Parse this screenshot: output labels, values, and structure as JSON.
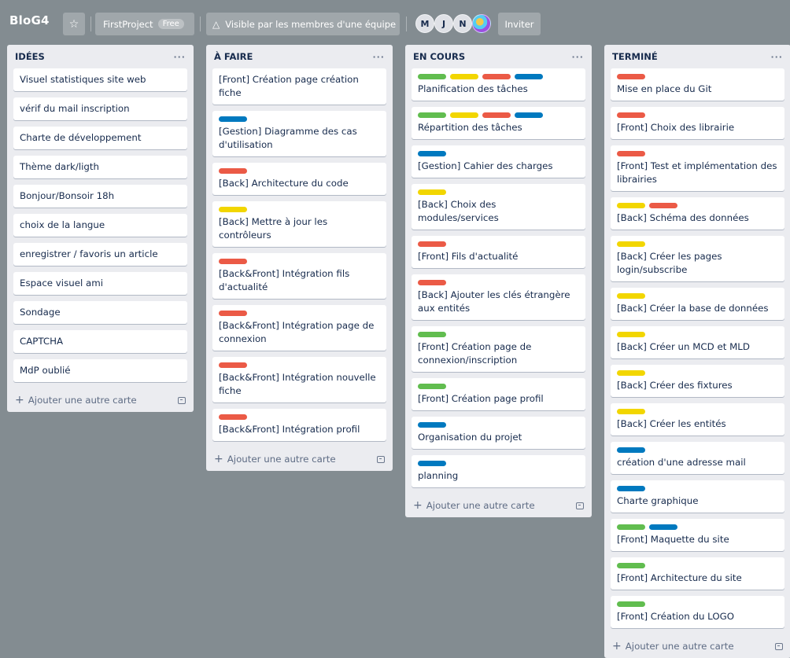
{
  "board": {
    "title": "BloG4",
    "star_icon": "star-icon",
    "workspace": "FirstProject",
    "workspace_badge": "Free",
    "visibility_icon": "team-icon",
    "visibility": "Visible par les membres d'une équipe",
    "members": [
      "M",
      "J",
      "N"
    ],
    "invite": "Inviter"
  },
  "add_card_label": "Ajouter une autre carte",
  "lists": [
    {
      "title": "IDÉES",
      "menu": "···",
      "cards": [
        {
          "text": "Visuel statistiques site web",
          "labels": []
        },
        {
          "text": "vérif du mail inscription",
          "labels": []
        },
        {
          "text": "Charte de développement",
          "labels": []
        },
        {
          "text": "Thème dark/ligth",
          "labels": []
        },
        {
          "text": "Bonjour/Bonsoir 18h",
          "labels": []
        },
        {
          "text": "choix de la langue",
          "labels": []
        },
        {
          "text": "enregistrer / favoris un article",
          "labels": []
        },
        {
          "text": "Espace visuel ami",
          "labels": []
        },
        {
          "text": "Sondage",
          "labels": []
        },
        {
          "text": "CAPTCHA",
          "labels": []
        },
        {
          "text": "MdP oublié",
          "labels": []
        }
      ]
    },
    {
      "title": "À FAIRE",
      "menu": "···",
      "cards": [
        {
          "text": "[Front] Création page création fiche",
          "labels": []
        },
        {
          "text": "[Gestion] Diagramme des cas d'utilisation",
          "labels": [
            "blue"
          ]
        },
        {
          "text": "[Back] Architecture du code",
          "labels": [
            "red"
          ]
        },
        {
          "text": "[Back] Mettre à jour les contrôleurs",
          "labels": [
            "yellow"
          ]
        },
        {
          "text": "[Back&Front] Intégration fils d'actualité",
          "labels": [
            "red"
          ]
        },
        {
          "text": "[Back&Front] Intégration page de connexion",
          "labels": [
            "red"
          ]
        },
        {
          "text": "[Back&Front] Intégration nouvelle fiche",
          "labels": [
            "red"
          ]
        },
        {
          "text": "[Back&Front] Intégration profil",
          "labels": [
            "red"
          ]
        }
      ]
    },
    {
      "title": "EN COURS",
      "menu": "···",
      "cards": [
        {
          "text": "Planification des tâches",
          "labels": [
            "green",
            "yellow",
            "red",
            "blue"
          ]
        },
        {
          "text": "Répartition des tâches",
          "labels": [
            "green",
            "yellow",
            "red",
            "blue"
          ]
        },
        {
          "text": "[Gestion] Cahier des charges",
          "labels": [
            "blue"
          ]
        },
        {
          "text": "[Back] Choix des modules/services",
          "labels": [
            "yellow"
          ]
        },
        {
          "text": "[Front] Fils d'actualité",
          "labels": [
            "red"
          ]
        },
        {
          "text": "[Back] Ajouter les clés étrangère aux entités",
          "labels": [
            "red"
          ]
        },
        {
          "text": "[Front] Création page de connexion/inscription",
          "labels": [
            "green"
          ]
        },
        {
          "text": "[Front] Création page profil",
          "labels": [
            "green"
          ]
        },
        {
          "text": "Organisation du projet",
          "labels": [
            "blue"
          ]
        },
        {
          "text": "planning",
          "labels": [
            "blue"
          ]
        }
      ]
    },
    {
      "title": "TERMINÉ",
      "menu": "···",
      "cards": [
        {
          "text": "Mise en place du Git",
          "labels": [
            "red"
          ]
        },
        {
          "text": "[Front] Choix des librairie",
          "labels": [
            "red"
          ]
        },
        {
          "text": "[Front] Test et implémentation des librairies",
          "labels": [
            "red"
          ]
        },
        {
          "text": "[Back] Schéma des données",
          "labels": [
            "yellow",
            "red"
          ]
        },
        {
          "text": "[Back] Créer les pages login/subscribe",
          "labels": [
            "yellow"
          ]
        },
        {
          "text": "[Back] Créer la base de données",
          "labels": [
            "yellow"
          ]
        },
        {
          "text": "[Back] Créer un MCD et MLD",
          "labels": [
            "yellow"
          ]
        },
        {
          "text": "[Back] Créer des fixtures",
          "labels": [
            "yellow"
          ]
        },
        {
          "text": "[Back] Créer les entités",
          "labels": [
            "yellow"
          ]
        },
        {
          "text": "création d'une adresse mail",
          "labels": [
            "blue"
          ]
        },
        {
          "text": "Charte graphique",
          "labels": [
            "blue"
          ]
        },
        {
          "text": "[Front] Maquette du site",
          "labels": [
            "green",
            "blue"
          ]
        },
        {
          "text": "[Front] Architecture du site",
          "labels": [
            "green"
          ]
        },
        {
          "text": "[Front] Création du LOGO",
          "labels": [
            "green"
          ]
        }
      ]
    }
  ]
}
